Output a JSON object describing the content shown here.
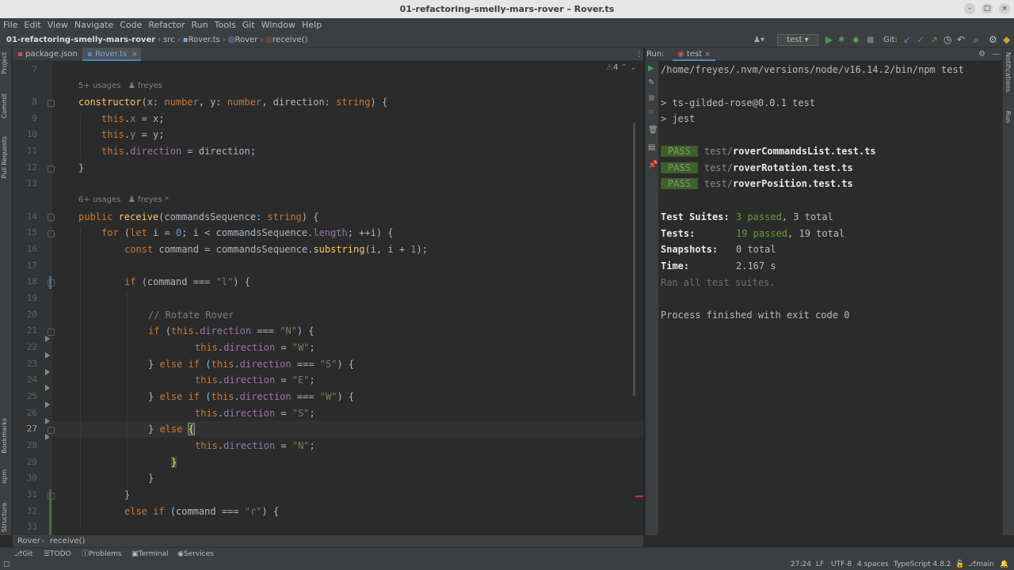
{
  "window": {
    "title": "01-refactoring-smelly-mars-rover – Rover.ts"
  },
  "menu": [
    "File",
    "Edit",
    "View",
    "Navigate",
    "Code",
    "Refactor",
    "Run",
    "Tools",
    "Git",
    "Window",
    "Help"
  ],
  "breadcrumb": {
    "project": "01-refactoring-smelly-mars-rover",
    "folder": "src",
    "file": "Rover.ts",
    "class": "Rover",
    "method": "receive()"
  },
  "toolbar": {
    "run_config": "test",
    "git_label": "Git:"
  },
  "tabs": [
    {
      "label": "package.json",
      "active": false
    },
    {
      "label": "Rover.ts",
      "active": true
    }
  ],
  "left_strip": [
    "Project",
    "Commit",
    "Pull Requests",
    "Bookmarks",
    "npm",
    "Structure"
  ],
  "right_strip": [
    "Notifications",
    "Run"
  ],
  "editor": {
    "hints": [
      {
        "usages": "5+ usages",
        "author": "freyes"
      },
      {
        "usages": "6+ usages",
        "author": "freyes *"
      }
    ],
    "warnings": "4",
    "line_numbers": [
      "7",
      "8",
      "9",
      "10",
      "11",
      "12",
      "13",
      "14",
      "15",
      "16",
      "17",
      "18",
      "19",
      "20",
      "21",
      "22",
      "23",
      "24",
      "25",
      "26",
      "27",
      "28",
      "29",
      "30",
      "31",
      "32",
      "33"
    ],
    "lines": {
      "l8": [
        "constructor",
        "(x: ",
        "number",
        ", y: ",
        "number",
        ", direction: ",
        "string",
        ") {"
      ],
      "l9": [
        "this",
        ".",
        "x",
        " = x;"
      ],
      "l10": [
        "this",
        ".",
        "y",
        " = y;"
      ],
      "l11": [
        "this",
        ".",
        "direction",
        " = direction;"
      ],
      "l12": "}",
      "l14": [
        "public ",
        "receive",
        "(commandsSequence: ",
        "string",
        ") {"
      ],
      "l15": [
        "for ",
        "(",
        "let ",
        "i = ",
        "0",
        "; i < commandsSequence.",
        "length",
        "; ++i) {"
      ],
      "l16": [
        "const ",
        "command = commandsSequence.",
        "substring",
        "(i, i + ",
        "1",
        ");"
      ],
      "l18": [
        "if ",
        "(command === ",
        "\"l\"",
        ") {"
      ],
      "l20": "// Rotate Rover",
      "l21": [
        "if ",
        "(",
        "this",
        ".",
        "direction",
        " === ",
        "\"N\"",
        ") {"
      ],
      "l22": [
        "this",
        ".",
        "direction",
        " = ",
        "\"W\"",
        ";"
      ],
      "l23": [
        "} ",
        "else if ",
        "(",
        "this",
        ".",
        "direction",
        " === ",
        "\"S\"",
        ") {"
      ],
      "l24": [
        "this",
        ".",
        "direction",
        " = ",
        "\"E\"",
        ";"
      ],
      "l25": [
        "} ",
        "else if ",
        "(",
        "this",
        ".",
        "direction",
        " === ",
        "\"W\"",
        ") {"
      ],
      "l26": [
        "this",
        ".",
        "direction",
        " = ",
        "\"S\"",
        ";"
      ],
      "l27": [
        "} ",
        "else ",
        "{"
      ],
      "l28": [
        "this",
        ".",
        "direction",
        " = ",
        "\"N\"",
        ";"
      ],
      "l29": "}",
      "l30": "}",
      "l31": "}",
      "l32": [
        "else if ",
        "(command === ",
        "\"r\"",
        ") {"
      ]
    }
  },
  "run": {
    "label": "Run:",
    "tab": "test",
    "command": "/home/freyes/.nvm/versions/node/v16.14.2/bin/npm test",
    "script1": "> ts-gilded-rose@0.0.1 test",
    "script2": "> jest",
    "results": [
      {
        "badge": "PASS",
        "dir": "test/",
        "file": "roverCommandsList.test.ts"
      },
      {
        "badge": "PASS",
        "dir": "test/",
        "file": "roverRotation.test.ts"
      },
      {
        "badge": "PASS",
        "dir": "test/",
        "file": "roverPosition.test.ts"
      }
    ],
    "summary": {
      "suites_label": "Test Suites:",
      "suites_passed": "3 passed",
      "suites_total": ", 3 total",
      "tests_label": "Tests:",
      "tests_passed": "19 passed",
      "tests_total": ", 19 total",
      "snap_label": "Snapshots:",
      "snap_value": "0 total",
      "time_label": "Time:",
      "time_value": "2.167 s",
      "ran": "Ran all test suites."
    },
    "exit": "Process finished with exit code 0"
  },
  "code_breadcrumb": [
    "Rover",
    "receive()"
  ],
  "tool_windows": [
    "Git",
    "TODO",
    "Problems",
    "Terminal",
    "Services"
  ],
  "status": {
    "position": "27:24",
    "eol": "LF",
    "encoding": "UTF-8",
    "indent": "4 spaces",
    "lang": "TypeScript 4.8.2",
    "branch": "main"
  }
}
